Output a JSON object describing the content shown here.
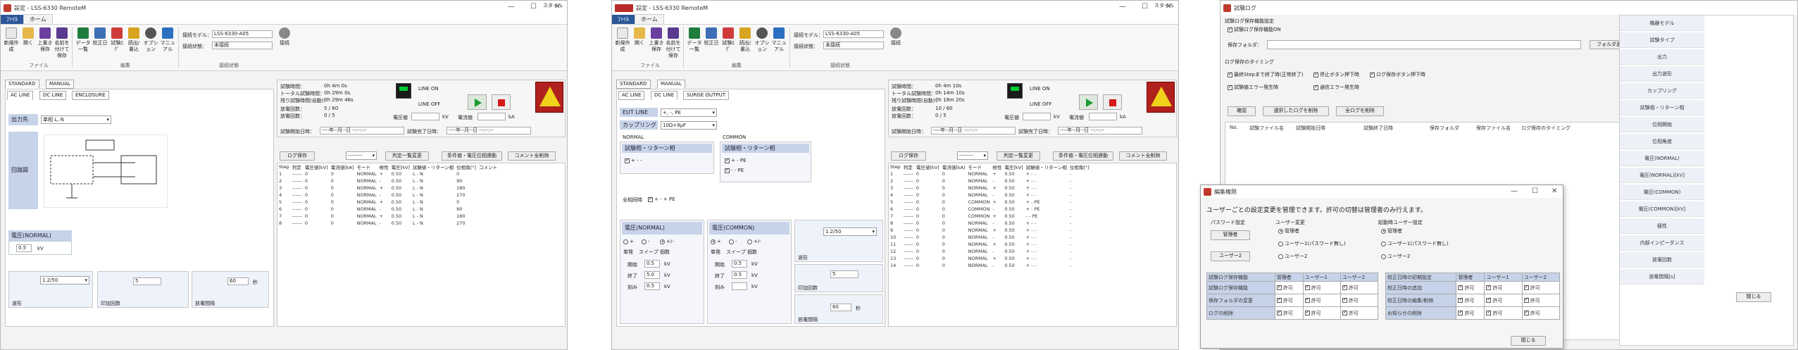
{
  "win1": {
    "title": "設定 - LSS-6330 RemoteM",
    "tab_file": "ﾌｧｲﾙ",
    "tab_home": "ホーム",
    "style_label": "スタイル",
    "ribbon_buttons": [
      "新規作成",
      "開く",
      "上書き保存",
      "名前を付けて保存",
      "データ一覧",
      "校正日",
      "試験ﾛｸﾞ",
      "読出/書込",
      "オプション",
      "マニュアル"
    ],
    "group_file": "ファイル",
    "group_edit": "編集",
    "group_conn": "接続状態",
    "model_label": "接続モデル：",
    "model_value": "LSS-6330-A05",
    "state_label": "接続状態：",
    "state_value": "未接続",
    "conn_button": "接続",
    "tabs_top": [
      "STANDARD",
      "MANUAL"
    ],
    "tabs_sub": [
      "AC LINE",
      "DC LINE",
      "ENCLOSURE"
    ],
    "phase_label": "出力先",
    "phase_value": "単相 L, N",
    "circuit_label": "回路図",
    "voltage_box": "電圧(NORMAL)",
    "voltage_value": "0.5",
    "voltage_unit": "kV",
    "wave_label": "波形",
    "wave_value": "1.2/50",
    "count_label": "印加回数",
    "count_value": "5",
    "interval_label": "放電間隔",
    "interval_value": "60",
    "interval_unit": "秒",
    "stats": {
      "time_label": "試験時間：",
      "time_value": "0h  4m  0s",
      "total_label": "トータル試験時間：",
      "total_value": "0h 29m  0s",
      "remain_label": "残り試験時間(自動)：",
      "remain_value": "0h 29m 46s",
      "disch_label": "放電回数：",
      "disch_value": "5 /  60",
      "times_label": "放電回数：",
      "times_value": "0 /   5"
    },
    "line_on": "LINE ON",
    "line_off": "LINE OFF",
    "volt_meas": "電圧値",
    "kv": "kV",
    "curr_meas": "電流値",
    "ka": "kA",
    "start_time_label": "試験開始日時：",
    "start_time_value": "----年--月--日  --:--:--",
    "end_time_label": "試験完了日時：",
    "end_time_value": "----年--月--日  --:--:--",
    "log_btn": "ログ保存",
    "combo_blank": "--------",
    "btn_judge": "判定一覧変更",
    "btn_cond": "条件値・電圧位相連動",
    "btn_comment": "コメント全削除",
    "columns": [
      "Step",
      "判定",
      "電圧値[kV]",
      "電流値[kA]",
      "モード",
      "極性",
      "電圧[kV]",
      "試験値・リターン相",
      "位相角[°]",
      "コメント"
    ],
    "rows": [
      [
        "1",
        "------",
        "0",
        "0",
        "NORMAL",
        "+",
        "0.50",
        "L - N",
        "0",
        ""
      ],
      [
        "2",
        "------",
        "0",
        "0",
        "NORMAL",
        "-",
        "0.50",
        "L - N",
        "90",
        ""
      ],
      [
        "3",
        "------",
        "0",
        "0",
        "NORMAL",
        "+",
        "0.50",
        "L - N",
        "180",
        ""
      ],
      [
        "4",
        "------",
        "0",
        "0",
        "NORMAL",
        "-",
        "0.50",
        "L - N",
        "270",
        ""
      ],
      [
        "5",
        "------",
        "0",
        "0",
        "NORMAL",
        "+",
        "0.50",
        "L - N",
        "0",
        ""
      ],
      [
        "6",
        "------",
        "0",
        "0",
        "NORMAL",
        "-",
        "0.50",
        "L - N",
        "90",
        ""
      ],
      [
        "7",
        "------",
        "0",
        "0",
        "NORMAL",
        "+",
        "0.50",
        "L - N",
        "180",
        ""
      ],
      [
        "8",
        "------",
        "0",
        "0",
        "NORMAL",
        "-",
        "0.50",
        "L - N",
        "270",
        ""
      ]
    ]
  },
  "win2": {
    "title": "設定 - LSS-6330 RemoteM",
    "tabs_sub": [
      "AC LINE",
      "DC LINE",
      "SURGE OUTPUT"
    ],
    "eut_line_label": "EUT LINE",
    "eut_line_value": "+, -, PE",
    "coupling_label": "カップリング",
    "coupling_value": "10Ω+9μF",
    "normal_label": "NORMAL",
    "common_label": "COMMON",
    "normal_ret": "試験相・リターン相",
    "common_ret": "試験相・リターン相",
    "normal_opts": [
      "+ - -"
    ],
    "common_opts": [
      "+ - PE",
      "- - PE"
    ],
    "pulse_label": "全相同時",
    "pulse_opt": "+ - + PE",
    "volt_normal": "電圧(NORMAL)",
    "volt_common": "電圧(COMMON)",
    "pol_opts": [
      "+",
      "-",
      "+/-"
    ],
    "sweep_tabs": [
      "単発",
      "スイープ",
      "個数"
    ],
    "start_l": "開始",
    "end_l": "終了",
    "step_l": "刻み",
    "sv": "0.5",
    "ev": "5.0",
    "stv": "0.5",
    "wave_value": "1.2/50",
    "count_value": "5",
    "interval_value": "60",
    "stats": {
      "time_value": "0h  4m 10s",
      "total_value": "0h 14m 10s",
      "remain_value": "0h 18m 20s",
      "disch_value": "10 /  60",
      "times_value": "0 /   5"
    },
    "rows": [
      [
        "1",
        "------",
        "0",
        "0",
        "NORMAL",
        "+",
        "0.50",
        "+ - -",
        "-"
      ],
      [
        "2",
        "------",
        "0",
        "0",
        "NORMAL",
        "-",
        "0.50",
        "+ - -",
        "-"
      ],
      [
        "3",
        "------",
        "0",
        "0",
        "NORMAL",
        "+",
        "0.50",
        "+ - -",
        "-"
      ],
      [
        "4",
        "------",
        "0",
        "0",
        "NORMAL",
        "-",
        "0.50",
        "+ - -",
        "-"
      ],
      [
        "5",
        "------",
        "0",
        "0",
        "COMMON",
        "+",
        "0.50",
        "+ - PE",
        "-"
      ],
      [
        "6",
        "------",
        "0",
        "0",
        "COMMON",
        "-",
        "0.50",
        "+ - PE",
        "-"
      ],
      [
        "7",
        "------",
        "0",
        "0",
        "COMMON",
        "+",
        "0.50",
        "- - PE",
        "-"
      ],
      [
        "8",
        "------",
        "0",
        "0",
        "NORMAL",
        "-",
        "0.50",
        "+ - -",
        "-"
      ],
      [
        "9",
        "------",
        "0",
        "0",
        "NORMAL",
        "+",
        "0.50",
        "+ - -",
        "-"
      ],
      [
        "10",
        "------",
        "0",
        "0",
        "NORMAL",
        "-",
        "0.50",
        "+ - -",
        "-"
      ],
      [
        "11",
        "------",
        "0",
        "0",
        "NORMAL",
        "+",
        "0.50",
        "+ - -",
        "-"
      ],
      [
        "12",
        "------",
        "0",
        "0",
        "NORMAL",
        "-",
        "0.50",
        "+ - -",
        "-"
      ],
      [
        "13",
        "------",
        "0",
        "0",
        "NORMAL",
        "+",
        "0.50",
        "+ - -",
        "-"
      ],
      [
        "14",
        "------",
        "0",
        "0",
        "NORMAL",
        "-",
        "0.50",
        "+ - -",
        "-"
      ]
    ]
  },
  "win3": {
    "title": "試験ログ",
    "save_group": "試験ログ保存機能設定",
    "save_enable": "試験ログ保存機能ON",
    "folder_label": "保存フォルダ：",
    "folder_btn": "フォルダ選択",
    "timing_group": "ログ保存のタイミング",
    "timing_opts": [
      "最終Stepまで終了時(正常終了)",
      "停止ボタン押下時",
      "ログ保存ボタン押下時",
      "試験値エラー発生時",
      "通信エラー発生時"
    ],
    "btn_confirm": "確認",
    "btn_del_sel": "選択したログを削除",
    "btn_del_all": "全ログを削除",
    "cols": [
      "No.",
      "試験ファイル名",
      "試験開始日時",
      "試験終了日時",
      "保存フォルダ",
      "保存ファイル名",
      "ログ保存のタイミング"
    ],
    "right_items": [
      "機器モデル",
      "試験タイプ",
      "出力",
      "出力波形",
      "カップリング",
      "試験相・リターン相",
      "位相開始",
      "位相角度",
      "電圧(NORMAL)",
      "電圧(NORMAL)[kV]",
      "電圧(COMMON)",
      "電圧(COMMON)[kV]",
      "極性",
      "内部インピーダンス",
      "放電回数",
      "放電間隔[s]"
    ],
    "close_btn": "閉じる"
  },
  "dlg": {
    "title": "編集権限",
    "desc": "ユーザーごとの設定変更を管理できます。許可の切替は管理者のみ行えます。",
    "pw_label": "パスワード設定",
    "admin_btn": "管理者",
    "user2_btn": "ユーザー2",
    "user_change": "ユーザー変更",
    "user_opts": [
      "管理者",
      "ユーザー1(パスワード無し)",
      "ユーザー2"
    ],
    "startup_label": "起動時ユーザー設定",
    "startup_opts": [
      "管理者",
      "ユーザー1(パスワード無し)",
      "ユーザー2"
    ],
    "tbl1_head": [
      "試験ログ保存機能",
      "管理者",
      "ユーザー1",
      "ユーザー2"
    ],
    "tbl1_rows": [
      "試験ログ保存機能",
      "保存フォルダの変更",
      "ログの削除"
    ],
    "tbl2_head": [
      "校正日時の初期設定",
      "管理者",
      "ユーザー1",
      "ユーザー2"
    ],
    "tbl2_rows": [
      "校正日時の追加",
      "校正日時の編集/削除",
      "お知らせの削除"
    ],
    "allow": "許可",
    "close_btn": "閉じる"
  }
}
